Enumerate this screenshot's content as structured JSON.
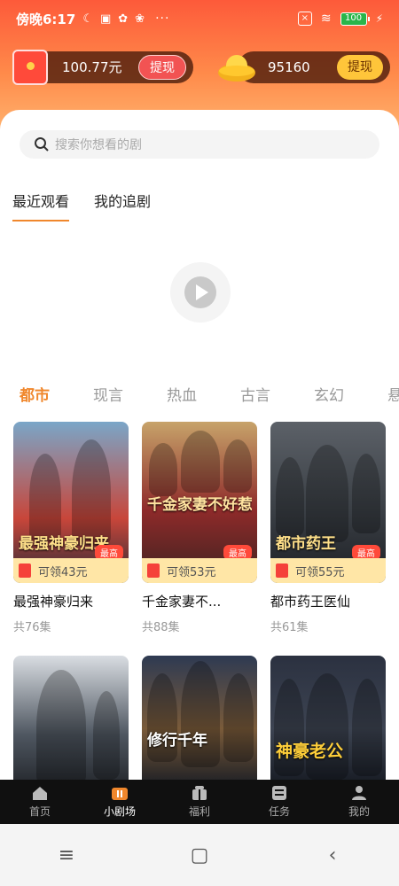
{
  "status_bar": {
    "time": "傍晚6:17",
    "battery": "100",
    "more": "···"
  },
  "wallet": {
    "cash_amount": "100.77元",
    "cash_withdraw": "提现",
    "coins_amount": "95160",
    "coins_withdraw": "提现"
  },
  "search": {
    "placeholder": "搜索你想看的剧"
  },
  "top_tabs": [
    {
      "label": "最近观看",
      "active": true
    },
    {
      "label": "我的追剧",
      "active": false
    }
  ],
  "categories": [
    "都市",
    "现言",
    "热血",
    "古言",
    "玄幻",
    "悬"
  ],
  "dramas": [
    {
      "title": "最强神豪归来",
      "poster_text": "最强神豪归来",
      "reward": "可领43元",
      "badge": "最高",
      "episodes": "共76集"
    },
    {
      "title": "千金家妻不...",
      "poster_text": "千金家妻不好惹",
      "reward": "可领53元",
      "badge": "最高",
      "episodes": "共88集"
    },
    {
      "title": "都市药王医仙",
      "poster_text": "都市药王",
      "reward": "可领55元",
      "badge": "最高",
      "episodes": "共61集"
    },
    {
      "poster_text": ""
    },
    {
      "poster_text": "修行千年"
    },
    {
      "poster_text": "神豪老公"
    }
  ],
  "bottom_nav": [
    {
      "label": "首页",
      "icon": "home-icon"
    },
    {
      "label": "小剧场",
      "icon": "theater-icon",
      "active": true
    },
    {
      "label": "福利",
      "icon": "gift-icon"
    },
    {
      "label": "任务",
      "icon": "task-icon"
    },
    {
      "label": "我的",
      "icon": "profile-icon"
    }
  ],
  "colors": {
    "accent": "#f0872c",
    "header_top": "#fd5a3a",
    "nav_bg": "#101010"
  }
}
